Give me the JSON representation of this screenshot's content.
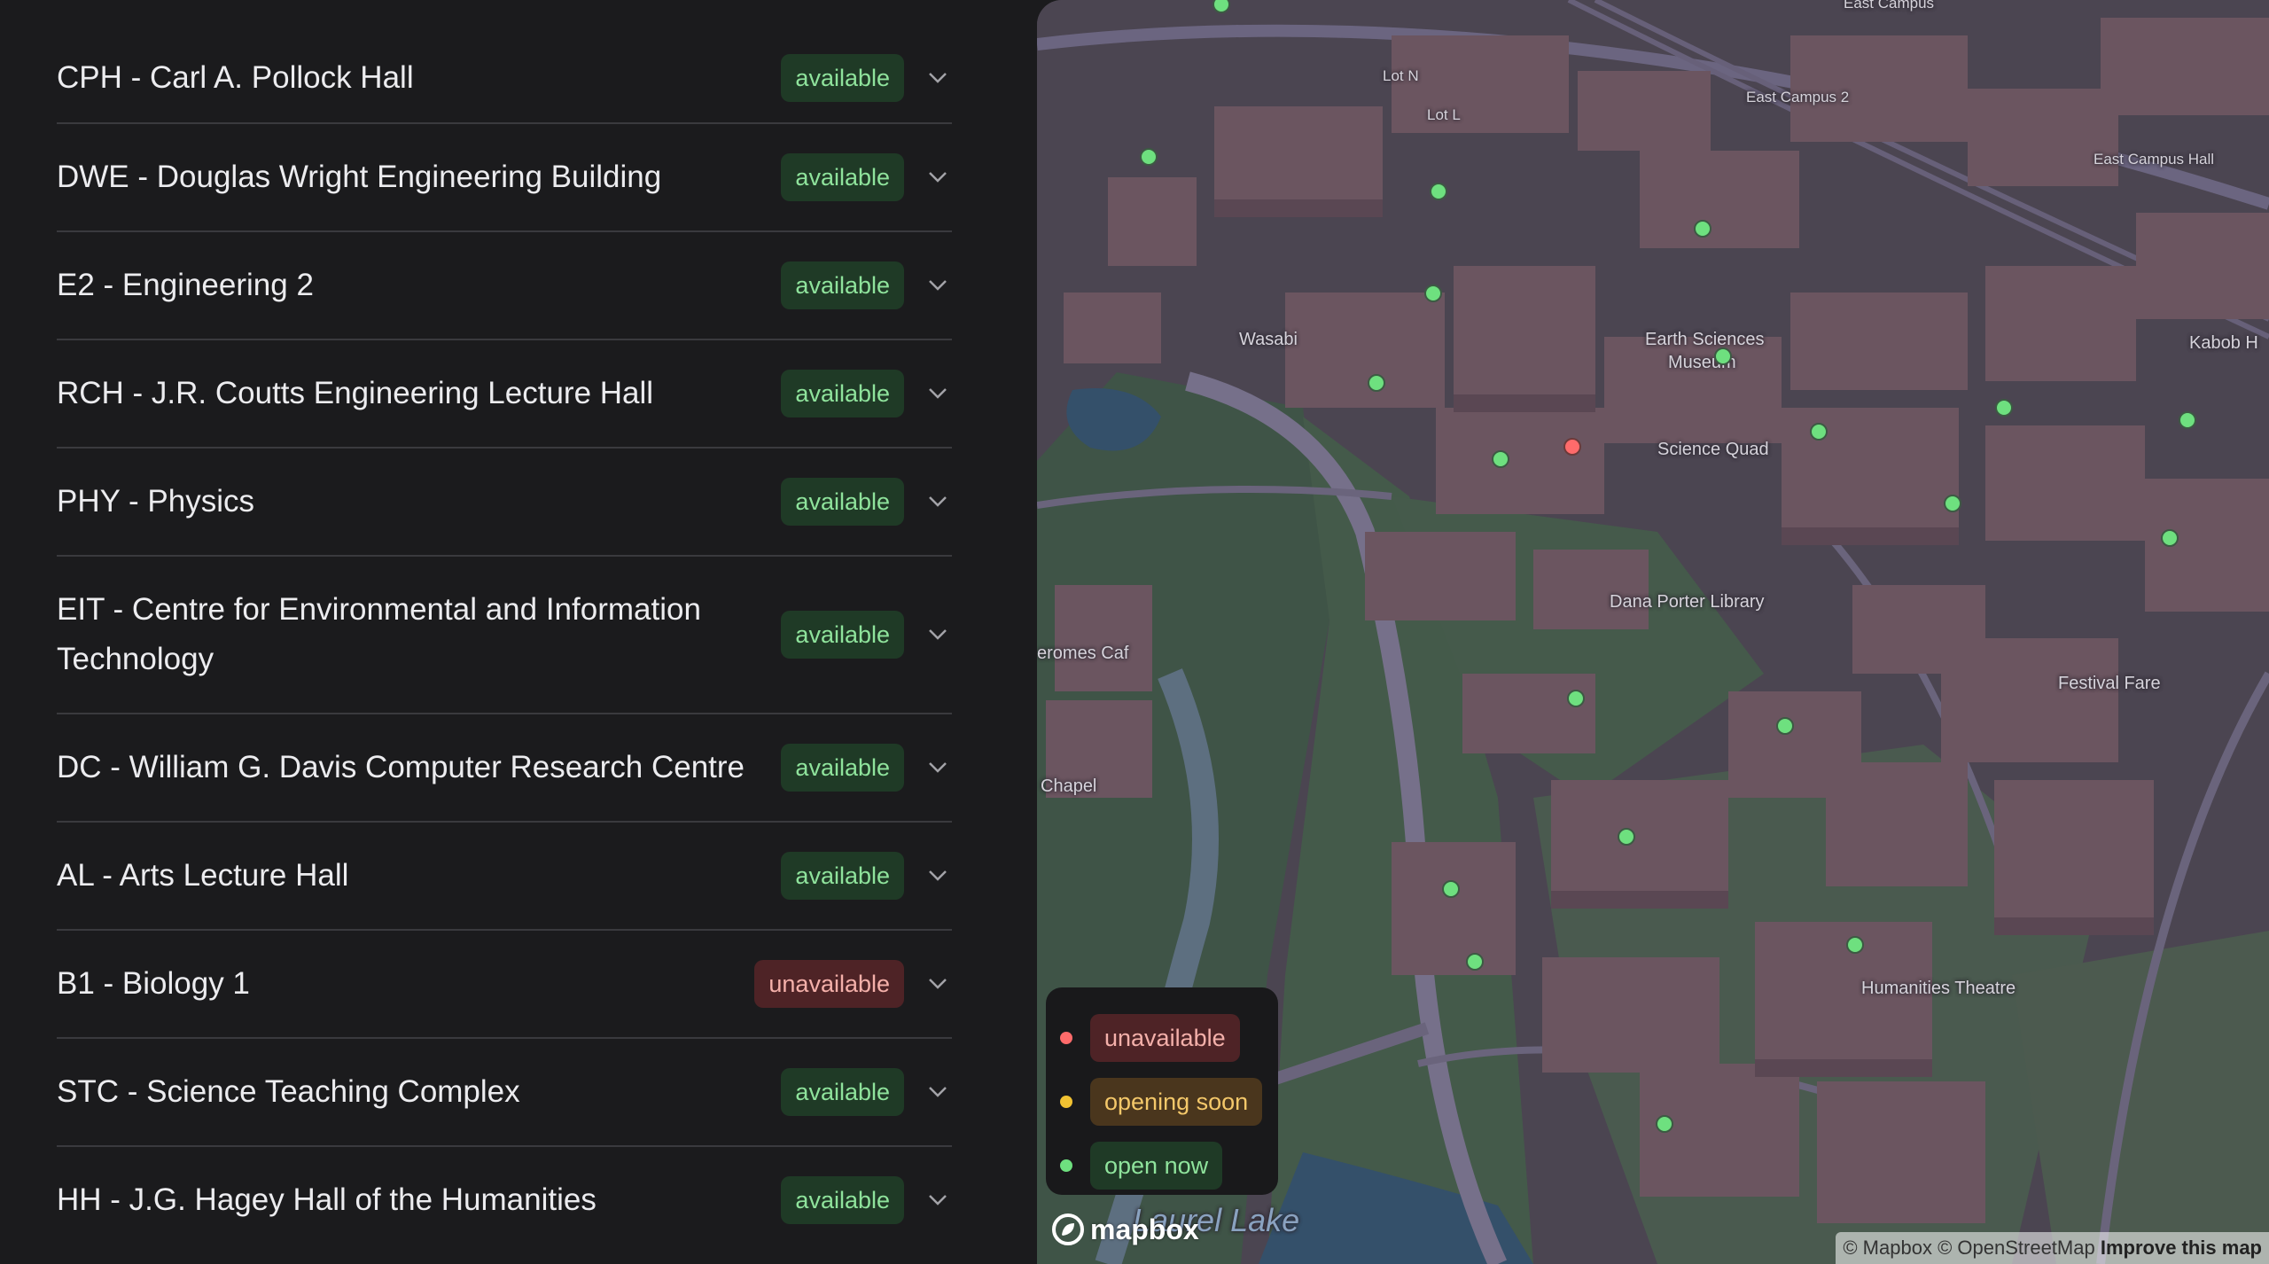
{
  "buildings": [
    {
      "name": "CPH - Carl A. Pollock Hall",
      "status": "available"
    },
    {
      "name": "DWE - Douglas Wright Engineering Building",
      "status": "available"
    },
    {
      "name": "E2 - Engineering 2",
      "status": "available"
    },
    {
      "name": "RCH - J.R. Coutts Engineering Lecture Hall",
      "status": "available"
    },
    {
      "name": "PHY - Physics",
      "status": "available"
    },
    {
      "name": "EIT - Centre for Environmental and Information Technology",
      "status": "available"
    },
    {
      "name": "DC - William G. Davis Computer Research Centre",
      "status": "available"
    },
    {
      "name": "AL - Arts Lecture Hall",
      "status": "available"
    },
    {
      "name": "B1 - Biology 1",
      "status": "unavailable"
    },
    {
      "name": "STC - Science Teaching Complex",
      "status": "available"
    },
    {
      "name": "HH - J.G. Hagey Hall of the Humanities",
      "status": "available"
    }
  ],
  "map": {
    "labels": {
      "lot_n": "Lot N",
      "lot_l": "Lot L",
      "east_campus": "East Campus",
      "east_campus_2": "East Campus 2",
      "east_campus_hall": "East Campus Hall",
      "wasabi": "Wasabi",
      "earth_sciences": "Earth Sciences",
      "museum": "Museum",
      "kabob": "Kabob H",
      "science_quad": "Science Quad",
      "dana_porter": "Dana Porter Library",
      "jeromes": "eromes Caf",
      "festival_fare": "Festival Fare",
      "chapel": "Chapel",
      "humanities_theatre": "Humanities Theatre",
      "laurel_lake": "Laurel Lake"
    },
    "legend": {
      "unavailable": "unavailable",
      "opening_soon": "opening soon",
      "open_now": "open now"
    },
    "attribution": {
      "mapbox": "© Mapbox",
      "osm": "© OpenStreetMap",
      "improve": "Improve this map"
    },
    "logo_text": "mapbox"
  },
  "colors": {
    "available": "#8fe39c",
    "unavailable": "#ff6b6b",
    "opening_soon": "#f1c232",
    "open_now": "#6ee07f"
  }
}
